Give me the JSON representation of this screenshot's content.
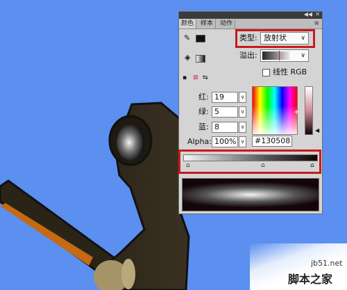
{
  "panel": {
    "tabs": [
      "颜色",
      "样本",
      "动作"
    ],
    "type_label": "类型:",
    "type_value": "放射状",
    "overflow_label": "溢出:",
    "linear_rgb_label": "线性 RGB",
    "linear_rgb_checked": false,
    "channels": [
      {
        "label": "红:",
        "value": "19"
      },
      {
        "label": "绿:",
        "value": "5"
      },
      {
        "label": "蓝:",
        "value": "8"
      },
      {
        "label": "Alpha:",
        "value": "100%"
      }
    ],
    "hex_value": "#130508",
    "gradient": {
      "stops": [
        {
          "color": "#f5f5f5",
          "position": 0.0
        },
        {
          "color": "#555555",
          "position": 0.62
        },
        {
          "color": "#130508",
          "position": 1.0
        }
      ]
    }
  },
  "colors": {
    "desktop_bg": "#5b8ff0",
    "highlight_box": "#c8191e",
    "selected_color": "#130508"
  },
  "watermark": {
    "site": "jb51.net",
    "brand": "脚本之家"
  }
}
